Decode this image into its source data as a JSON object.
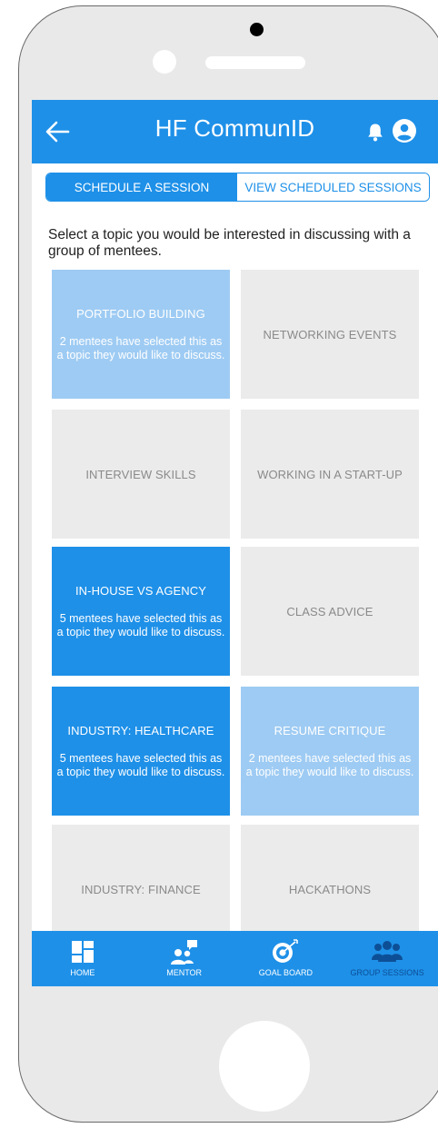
{
  "header": {
    "title": "HF CommunID"
  },
  "icons": {
    "back": "arrow-left",
    "notifications": "bell",
    "account": "user-circle"
  },
  "tabs": [
    {
      "label": "SCHEDULE A SESSION",
      "active": true
    },
    {
      "label": "VIEW SCHEDULED SESSIONS",
      "active": false
    }
  ],
  "intro": "Select a topic you would be interested in discussing with a group of mentees.",
  "topics": [
    {
      "title": "PORTFOLIO BUILDING",
      "subtitle": "2 mentees have selected this as a topic they would like to discuss.",
      "style": "light"
    },
    {
      "title": "NETWORKING EVENTS",
      "subtitle": "",
      "style": "gray"
    },
    {
      "title": "INTERVIEW SKILLS",
      "subtitle": "",
      "style": "gray"
    },
    {
      "title": "WORKING IN A START-UP",
      "subtitle": "",
      "style": "gray"
    },
    {
      "title": "IN-HOUSE VS AGENCY",
      "subtitle": "5 mentees have selected this as a topic they would like to discuss.",
      "style": "blue"
    },
    {
      "title": "CLASS ADVICE",
      "subtitle": "",
      "style": "gray"
    },
    {
      "title": "INDUSTRY: HEALTHCARE",
      "subtitle": "5 mentees have selected this as a topic they would like to discuss.",
      "style": "blue"
    },
    {
      "title": "RESUME CRITIQUE",
      "subtitle": "2 mentees have selected this as a topic they would like to discuss.",
      "style": "light"
    },
    {
      "title": "INDUSTRY: FINANCE",
      "subtitle": "",
      "style": "gray"
    },
    {
      "title": "HACKATHONS",
      "subtitle": "",
      "style": "gray"
    }
  ],
  "nav": [
    {
      "label": "HOME",
      "icon": "dashboard-icon",
      "active": false
    },
    {
      "label": "MENTOR",
      "icon": "mentor-chat-icon",
      "active": false
    },
    {
      "label": "GOAL BOARD",
      "icon": "target-icon",
      "active": false
    },
    {
      "label": "GROUP SESSIONS",
      "icon": "group-icon",
      "active": true
    }
  ],
  "colors": {
    "primary": "#1E90E8",
    "selected_light": "#9ECBF3",
    "tile_gray": "#EBEBEB",
    "nav_active_label": "#0d4f96"
  }
}
